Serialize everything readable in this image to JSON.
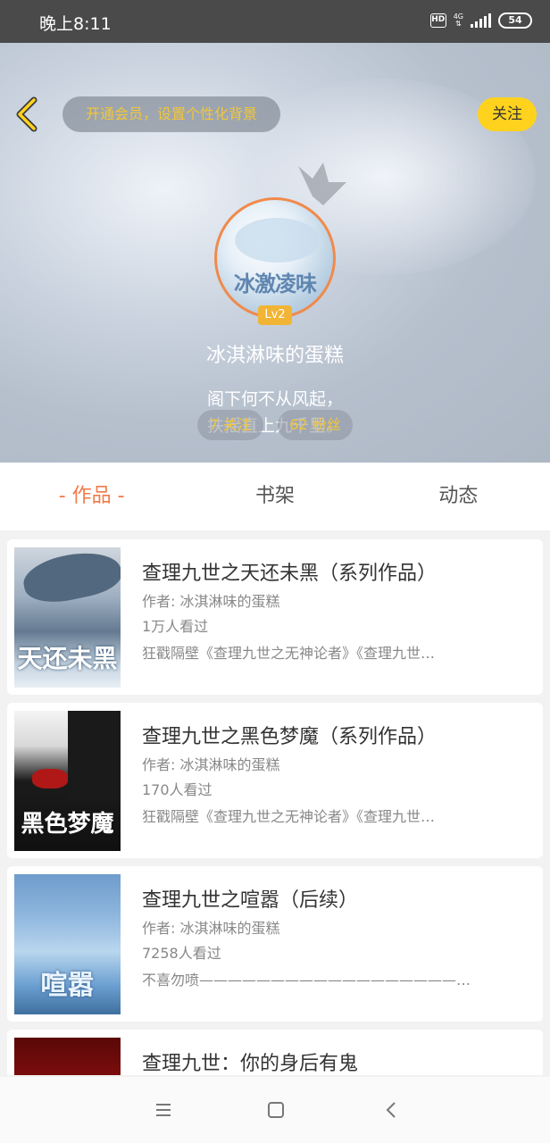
{
  "status_bar": {
    "time": "晚上8:11",
    "hd": "HD",
    "network": "4G",
    "battery": "54"
  },
  "header": {
    "vip_text": "开通会员，设置个性化背景",
    "follow_label": "关注",
    "avatar_text": "冰激凌味",
    "level": "Lv2",
    "username": "冰淇淋味的蛋糕",
    "bio_line1": "阁下何不从风起，",
    "bio_line2": "扶摇直上九千里。",
    "following": "7 关注",
    "followers": "62 粉丝"
  },
  "tabs": [
    {
      "label": "- 作品 -",
      "active": true
    },
    {
      "label": "书架",
      "active": false
    },
    {
      "label": "动态",
      "active": false
    }
  ],
  "works": [
    {
      "title": "查理九世之天还未黑（系列作品）",
      "author": "作者: 冰淇淋味的蛋糕",
      "views": "1万人看过",
      "desc": "狂戳隔壁《查理九世之无神论者》《查理九世…",
      "cover_text": "天还未黑"
    },
    {
      "title": "查理九世之黑色梦魔（系列作品）",
      "author": "作者: 冰淇淋味的蛋糕",
      "views": "170人看过",
      "desc": "狂戳隔壁《查理九世之无神论者》《查理九世…",
      "cover_text": "黑色梦魔"
    },
    {
      "title": "查理九世之喧嚣（后续）",
      "author": "作者: 冰淇淋味的蛋糕",
      "views": "7258人看过",
      "desc": "不喜勿喷——————————————————…",
      "cover_text": "喧嚣"
    },
    {
      "title": "查理九世：你的身后有鬼",
      "author": "",
      "views": "",
      "desc": "",
      "cover_text": ""
    }
  ],
  "colors": {
    "accent": "#f07a4a",
    "gold": "#f3c638",
    "follow_bg": "#ffd21e",
    "level_bg": "#f2b434"
  }
}
